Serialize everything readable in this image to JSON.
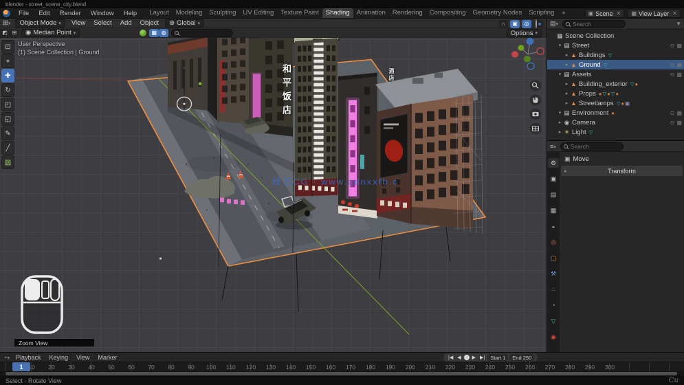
{
  "titlebar": {
    "title": "blender - street_scene_city.blend"
  },
  "menubar": {
    "menus": [
      "File",
      "Edit",
      "Render",
      "Window",
      "Help"
    ],
    "tabs": [
      "Layout",
      "Modeling",
      "Sculpting",
      "UV Editing",
      "Texture Paint",
      "Shading",
      "Animation",
      "Rendering",
      "Compositing",
      "Geometry Nodes",
      "Scripting"
    ],
    "active_tab": "Shading",
    "add_tab": "+",
    "scene_selector": {
      "label": "Scene"
    },
    "layer_selector": {
      "label": "View Layer"
    }
  },
  "viewport": {
    "header": {
      "mode": "Object Mode",
      "menus": [
        "View",
        "Select",
        "Add",
        "Object"
      ],
      "orientation": "Global",
      "pivot": "Median Point",
      "options": "Options",
      "search_placeholder": ""
    },
    "overlay": {
      "line1": "User Perspective",
      "line2": "(1) Scene Collection | Ground"
    },
    "watermark": "绘艺CG · www.qdnxxfb.c",
    "signs": {
      "hotel": "和平饭店",
      "side": "酒店"
    },
    "tools": [
      "select-box",
      "cursor",
      "move",
      "rotate",
      "scale",
      "transform",
      "annotate",
      "measure",
      "add-cube"
    ],
    "active_tool": "move",
    "screencast": {
      "hint": "Zoom View"
    }
  },
  "outliner": {
    "search_placeholder": "Search",
    "rows": [
      {
        "label": "Scene Collection",
        "depth": 0,
        "icon": "scene-collection",
        "arrow": "none",
        "selected": false,
        "extras": [],
        "right": false
      },
      {
        "label": "Street",
        "depth": 1,
        "icon": "collection",
        "arrow": "down",
        "selected": false,
        "extras": [],
        "right": true
      },
      {
        "label": "Buildings",
        "depth": 2,
        "icon": "mesh",
        "arrow": "right",
        "selected": false,
        "extras": [
          "data"
        ],
        "right": false
      },
      {
        "label": "Ground",
        "depth": 2,
        "icon": "mesh",
        "arrow": "right",
        "selected": true,
        "extras": [
          "data"
        ],
        "right": true
      },
      {
        "label": "Assets",
        "depth": 1,
        "icon": "collection",
        "arrow": "down",
        "selected": false,
        "extras": [],
        "right": true
      },
      {
        "label": "Building_exterior",
        "depth": 2,
        "icon": "mesh",
        "arrow": "right",
        "selected": false,
        "extras": [
          "data",
          "material"
        ],
        "right": false
      },
      {
        "label": "Props",
        "depth": 2,
        "icon": "mesh",
        "arrow": "right",
        "selected": false,
        "extras": [
          "material",
          "data",
          "material",
          "data",
          "material"
        ],
        "right": false
      },
      {
        "label": "Streetlamps",
        "depth": 2,
        "icon": "mesh",
        "arrow": "right",
        "selected": false,
        "extras": [
          "data",
          "material",
          "image"
        ],
        "right": false
      },
      {
        "label": "Environment",
        "depth": 1,
        "icon": "collection",
        "arrow": "down",
        "selected": false,
        "extras": [
          "material"
        ],
        "right": true
      },
      {
        "label": "Camera",
        "depth": 1,
        "icon": "camera",
        "arrow": "right",
        "selected": false,
        "extras": [],
        "right": true
      },
      {
        "label": "Light",
        "depth": 1,
        "icon": "light",
        "arrow": "right",
        "selected": false,
        "extras": [
          "data"
        ],
        "right": false
      }
    ]
  },
  "properties": {
    "search_placeholder": "Search",
    "tabs": [
      "tool",
      "render",
      "output",
      "view-layer",
      "scene",
      "world",
      "object",
      "modifiers",
      "particles",
      "physics",
      "data",
      "material"
    ],
    "active_tab": "tool",
    "breadcrumb": "Move",
    "panel": "Transform"
  },
  "timeline": {
    "menus": [
      "Playback",
      "Keying",
      "View",
      "Marker"
    ],
    "current_frame": "1",
    "start_field": "Start 1",
    "end_field": "End 250",
    "frame_labels": [
      10,
      20,
      30,
      40,
      50,
      60,
      70,
      80,
      90,
      100,
      110,
      120,
      130,
      140,
      150,
      160,
      170,
      180,
      190,
      200,
      210,
      220,
      230,
      240,
      250,
      260,
      270,
      280,
      290,
      300
    ]
  },
  "statusbar": {
    "left": "Select  ·  Rotate View",
    "signature": "Cu"
  }
}
